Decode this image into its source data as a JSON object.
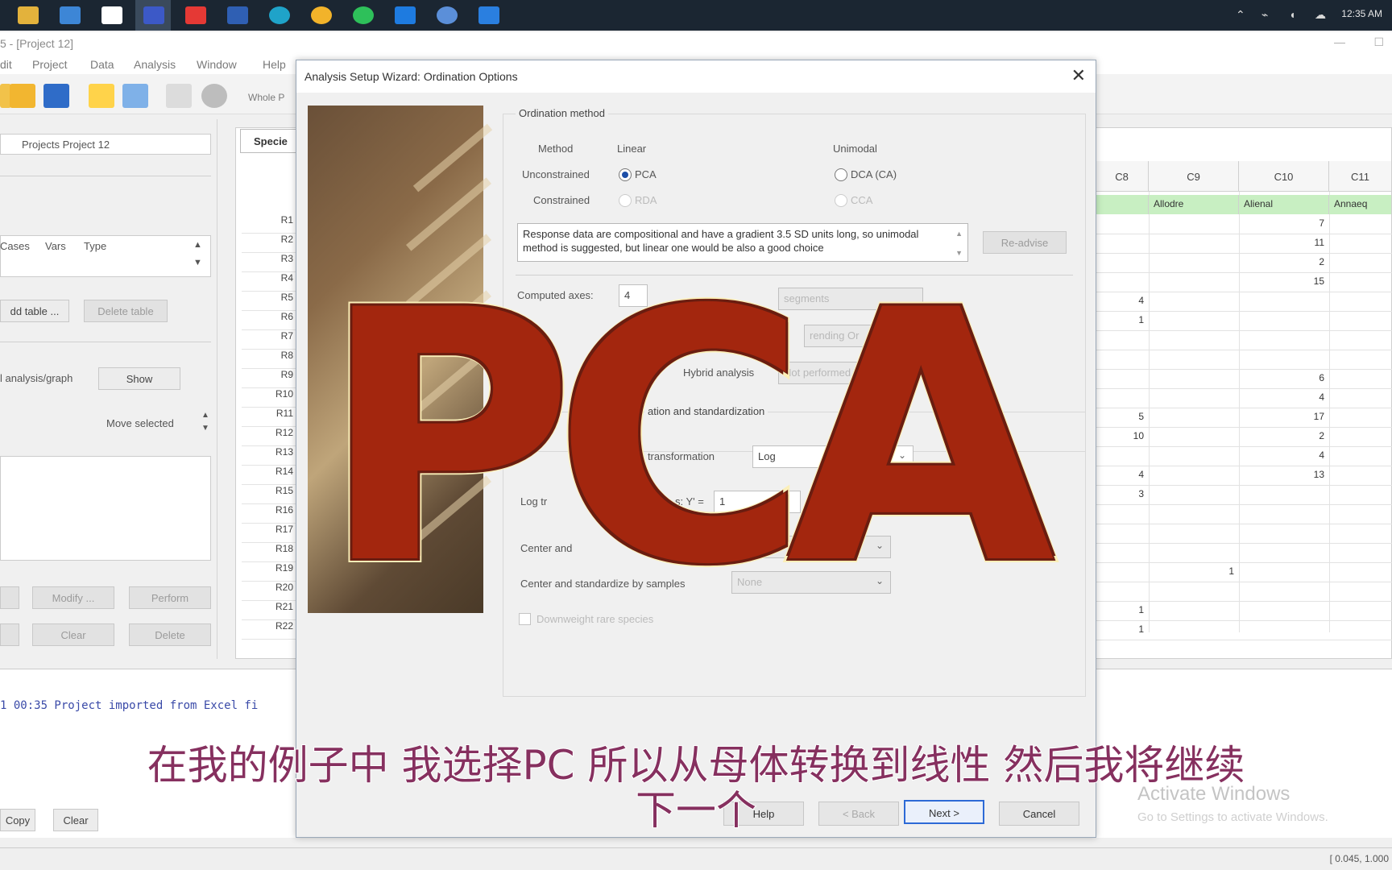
{
  "taskbar": {
    "time": "12:35 AM",
    "icons": [
      "file-explorer-icon",
      "mail-icon",
      "calendar-icon",
      "app-icon",
      "youtube-icon",
      "word-icon",
      "edge-icon",
      "chrome-icon",
      "whatsapp-icon",
      "store-icon",
      "globe-icon",
      "photos-icon"
    ]
  },
  "app": {
    "title": "5 - [Project 12]",
    "menu": [
      "dit",
      "Project",
      "Data",
      "Analysis",
      "Window",
      "Help"
    ],
    "toolbar_partial": "Whole P"
  },
  "left_panel": {
    "project_field": "Projects Project 12",
    "table_headers": [
      "Cases",
      "Vars",
      "Type"
    ],
    "add_table": "dd table ...",
    "delete_table": "Delete table",
    "analysis_label": "l analysis/graph",
    "show": "Show",
    "move_selected": "Move selected",
    "modify": "Modify ...",
    "perform": "Perform",
    "clear": "Clear",
    "delete": "Delete"
  },
  "grid": {
    "tab": "Specie",
    "row_headers": [
      "R1",
      "R2",
      "R3",
      "R4",
      "R5",
      "R6",
      "R7",
      "R8",
      "R9",
      "R10",
      "R11",
      "R12",
      "R13",
      "R14",
      "R15",
      "R16",
      "R17",
      "R18",
      "R19",
      "R20",
      "R21",
      "R22"
    ],
    "col_headers": [
      "C8",
      "C9",
      "C10",
      "C11"
    ],
    "green_row": [
      "",
      "Allodre",
      "Alienal",
      "Annaeq"
    ],
    "c10_values": [
      "7",
      "11",
      "2",
      "15",
      "",
      "",
      "",
      "",
      "6",
      "4",
      "17",
      "2",
      "4",
      "13"
    ],
    "c8_values": [
      "",
      "",
      "",
      "",
      "4",
      "1",
      "",
      "",
      "",
      "",
      "5",
      "10",
      "",
      "4",
      "3"
    ],
    "c9_value": "1",
    "c8_bottom": [
      "1",
      "1"
    ]
  },
  "log": {
    "line": "1 00:35 Project imported from Excel fi",
    "copy": "Copy",
    "clear": "Clear",
    "status": "[ 0.045, 1.000"
  },
  "watermark": {
    "line1": "Activate Windows",
    "line2": "Go to Settings to activate Windows."
  },
  "dialog": {
    "title": "Analysis Setup Wizard: Ordination Options",
    "ordination_group": "Ordination method",
    "method_label": "Method",
    "linear_label": "Linear",
    "unimodal_label": "Unimodal",
    "unconstrained_label": "Unconstrained",
    "constrained_label": "Constrained",
    "pca": "PCA",
    "dca": "DCA (CA)",
    "rda": "RDA",
    "cca": "CCA",
    "advice_text": "Response data are compositional and have a gradient 3.5 SD units long, so unimodal method is suggested, but linear one would be also a good choice",
    "re_advise": "Re-advise",
    "computed_axes": "Computed axes:",
    "axes_value": "4",
    "segments": "segments",
    "detrending": "rending Or",
    "hybrid_label": "Hybrid analysis",
    "hybrid_value": "Not performed",
    "transform_group": "ation and standardization",
    "transform_label": ") transformation",
    "transform_value": "Log",
    "log_label": "Log tr",
    "log_eq": "s: Y' =",
    "log_value": "1",
    "center_label": "Center and",
    "center_samples_label": "Center and standardize by samples",
    "center_samples_value": "None",
    "downweight": "Downweight rare species",
    "help": "Help",
    "back": "< Back",
    "next": "Next >",
    "cancel": "Cancel"
  },
  "overlay": {
    "big_text": "PCA",
    "subtitle_line1": "在我的例子中 我选择PC 所以从母体转换到线性 然后我将继续",
    "subtitle_line2": "下一个"
  },
  "colors": {
    "accent": "#2d6ad6",
    "overlay_red": "#a3260e",
    "overlay_outline": "#fbefb8",
    "subtitle": "#86305f",
    "green_cells": "#c8efc2"
  }
}
